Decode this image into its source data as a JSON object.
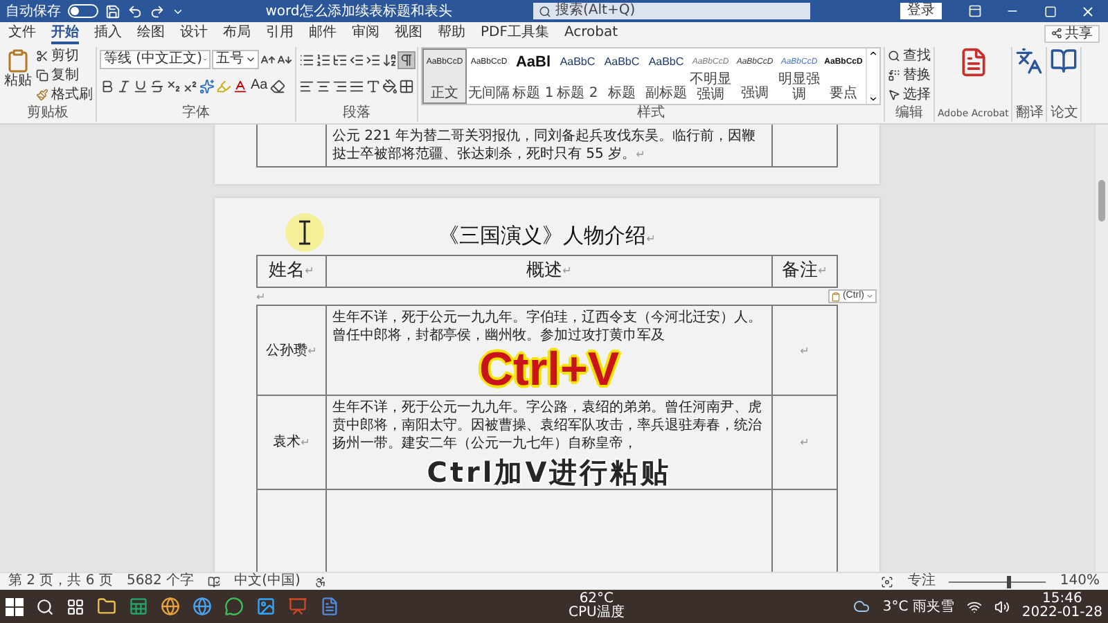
{
  "title_bar": {
    "autosave_label": "自动保存",
    "autosave_on": false,
    "title": "word怎么添加续表标题和表头",
    "search_placeholder": "搜索(Alt+Q)",
    "sign_in": "登录"
  },
  "tabs": [
    {
      "label": "文件",
      "selected": false
    },
    {
      "label": "开始",
      "selected": true
    },
    {
      "label": "插入",
      "selected": false
    },
    {
      "label": "绘图",
      "selected": false
    },
    {
      "label": "设计",
      "selected": false
    },
    {
      "label": "布局",
      "selected": false
    },
    {
      "label": "引用",
      "selected": false
    },
    {
      "label": "邮件",
      "selected": false
    },
    {
      "label": "审阅",
      "selected": false
    },
    {
      "label": "视图",
      "selected": false
    },
    {
      "label": "帮助",
      "selected": false
    },
    {
      "label": "PDF工具集",
      "selected": false
    },
    {
      "label": "Acrobat",
      "selected": false
    }
  ],
  "share": "共享",
  "ribbon": {
    "clipboard": {
      "paste": "粘贴",
      "cut": "剪切",
      "copy": "复制",
      "format_painter": "格式刷",
      "label": "剪贴板"
    },
    "font": {
      "name": "等线 (中文正文)",
      "size": "五号",
      "case": "Aa",
      "label": "字体"
    },
    "paragraph": {
      "show_marks": true,
      "label": "段落"
    },
    "styles": {
      "label": "样式",
      "items": [
        {
          "sample": "AaBbCcD",
          "name": "正文",
          "kind": "normal",
          "selected": true
        },
        {
          "sample": "AaBbCcD",
          "name": "无间隔",
          "kind": "normal",
          "selected": false
        },
        {
          "sample": "AaBl",
          "name": "标题 1",
          "kind": "heading1",
          "selected": false
        },
        {
          "sample": "AaBbC",
          "name": "标题 2",
          "kind": "heading",
          "selected": false
        },
        {
          "sample": "AaBbC",
          "name": "标题",
          "kind": "heading",
          "selected": false
        },
        {
          "sample": "AaBbC",
          "name": "副标题",
          "kind": "heading",
          "selected": false
        },
        {
          "sample": "AaBbCcD",
          "name": "不明显强调",
          "kind": "subtle",
          "selected": false
        },
        {
          "sample": "AaBbCcD",
          "name": "强调",
          "kind": "emphasis",
          "selected": false
        },
        {
          "sample": "AaBbCcD",
          "name": "明显强调",
          "kind": "intense",
          "selected": false
        },
        {
          "sample": "AaBbCcD",
          "name": "要点",
          "kind": "strong",
          "selected": false
        }
      ]
    },
    "editing": {
      "find": "查找",
      "replace": "替换",
      "select": "选择",
      "label": "编辑"
    },
    "acrobat": {
      "label": "Adobe Acrobat"
    },
    "translate": {
      "label": "翻译"
    },
    "paper": {
      "label": "论文"
    }
  },
  "document": {
    "page1_row": {
      "text": "公元 221 年为替二哥关羽报仇，同刘备起兵攻伐东吴。临行前，因鞭挞士卒被部将范疆、张达刺杀，死时只有 55 岁。",
      "mark": "↵"
    },
    "title": "《三国演义》人物介绍",
    "title_mark": "↵",
    "header": [
      {
        "text": "姓名",
        "mark": "↵"
      },
      {
        "text": "概述",
        "mark": "↵"
      },
      {
        "text": "备注",
        "mark": "↵"
      }
    ],
    "blank_mark": "↵",
    "paste_options": "(Ctrl)",
    "rows": [
      {
        "name": "公孙瓒",
        "name_mark": "↵",
        "desc": "生年不详，死于公元一九九年。字伯珪，辽西令支（今河北迁安）人。曾任中郎将，封都亭侯，幽州牧。参加过攻打黄巾军及",
        "remark_mark": "↵",
        "overlay": {
          "text": "Ctrl+V",
          "kind": "key"
        }
      },
      {
        "name": "袁术",
        "name_mark": "↵",
        "desc": "生年不详，死于公元一九九年。字公路，袁绍的弟弟。曾任河南尹、虎贲中郎将，南阳太守。因被曹操、袁绍军队攻击，率兵退驻寿春，统治扬州一带。建安二年（公元一九七年）自称皇帝，",
        "remark_mark": "↵",
        "overlay": {
          "text": "Ctrl加V进行粘贴",
          "kind": "subtitle"
        }
      }
    ]
  },
  "status_bar": {
    "page": "第 2 页，共 6 页",
    "words": "5682 个字",
    "language": "中文(中国)",
    "focus": "专注",
    "zoom": "140%",
    "zoom_slider": {
      "level": 0.6
    }
  },
  "taskbar": {
    "cpu_temp": "62°C",
    "cpu_label": "CPU温度",
    "weather": "3°C 雨夹雪",
    "time": "15:46",
    "date": "2022-01-28"
  }
}
